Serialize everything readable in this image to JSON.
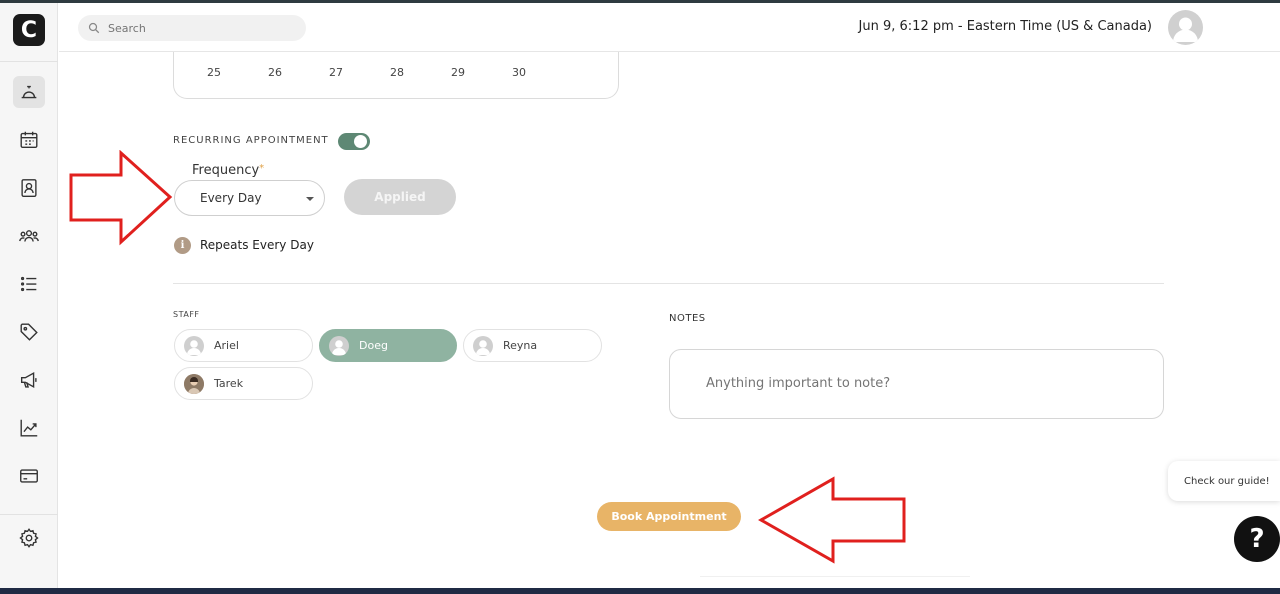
{
  "header": {
    "search_placeholder": "Search",
    "datetime": "Jun 9, 6:12 pm - Eastern Time (US & Canada)"
  },
  "sidebar": {
    "logo": "C",
    "items": [
      {
        "name": "bell-icon",
        "active": true
      },
      {
        "name": "calendar-icon",
        "active": false
      },
      {
        "name": "contacts-icon",
        "active": false
      },
      {
        "name": "team-icon",
        "active": false
      },
      {
        "name": "list-icon",
        "active": false
      },
      {
        "name": "tag-icon",
        "active": false
      },
      {
        "name": "megaphone-icon",
        "active": false
      },
      {
        "name": "chart-icon",
        "active": false
      },
      {
        "name": "card-icon",
        "active": false
      },
      {
        "name": "gear-icon",
        "active": false
      }
    ]
  },
  "calendar": {
    "days": [
      "25",
      "26",
      "27",
      "28",
      "29",
      "30"
    ]
  },
  "recurring": {
    "label": "RECURRING APPOINTMENT",
    "enabled": true,
    "frequency_label": "Frequency",
    "required_mark": "*",
    "frequency_value": "Every Day",
    "applied_label": "Applied",
    "info_glyph": "i",
    "repeats_text": "Repeats Every Day"
  },
  "staff": {
    "label": "STAFF",
    "members": [
      {
        "name": "Ariel",
        "selected": false
      },
      {
        "name": "Doeg",
        "selected": true
      },
      {
        "name": "Reyna",
        "selected": false
      },
      {
        "name": "Tarek",
        "selected": false
      }
    ]
  },
  "notes": {
    "label": "NOTES",
    "placeholder": "Anything important to note?"
  },
  "book_label": "Book Appointment",
  "guide_text": "Check our guide!",
  "help_glyph": "?",
  "colors": {
    "accent_green": "#5e8874",
    "selected_chip": "#8fb3a1",
    "book_button": "#e8b467",
    "annotation_red": "#e0201e"
  }
}
